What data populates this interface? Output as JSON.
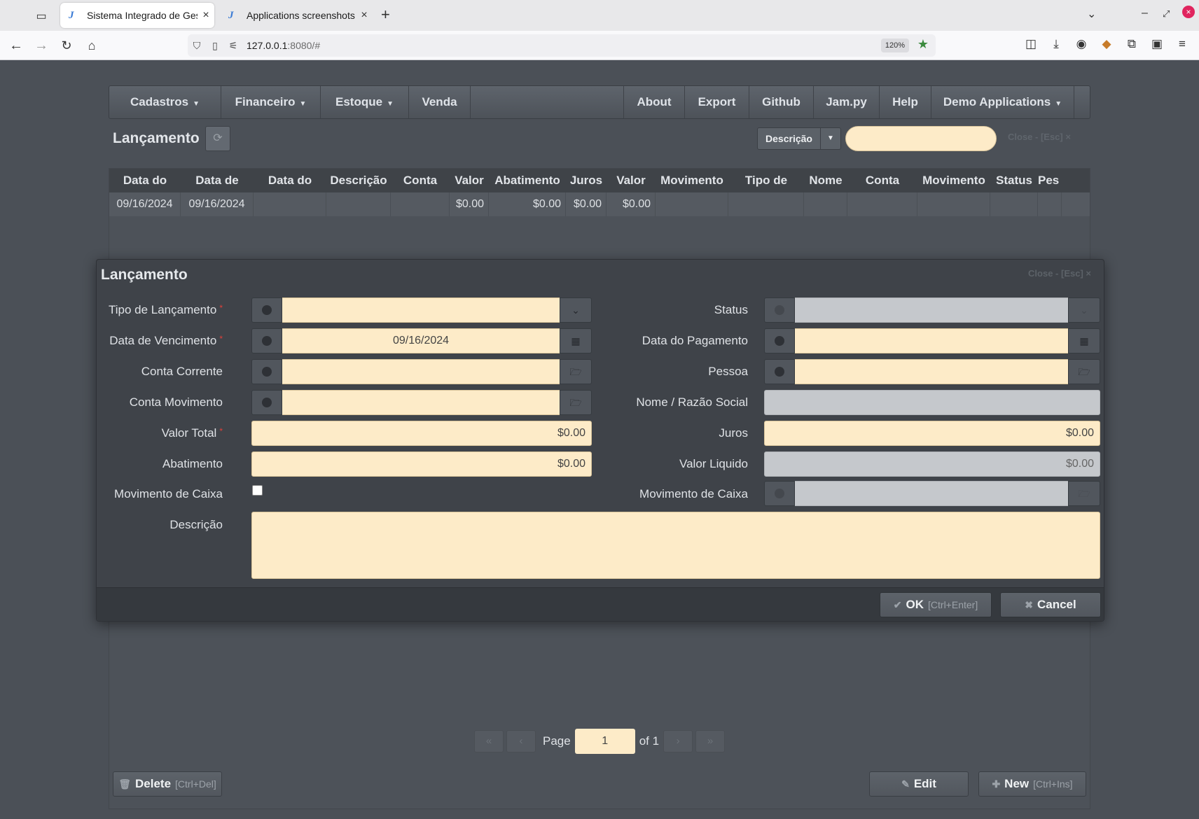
{
  "browser": {
    "tabs": [
      {
        "label": "Sistema Integrado de Gestã",
        "active": true,
        "favicon": "J"
      },
      {
        "label": "Applications screenshots —",
        "active": false,
        "favicon": "J"
      }
    ],
    "url_host": "127.0.0.1",
    "url_rest": ":8080/#",
    "zoom": "120%"
  },
  "menu": {
    "left": [
      "Cadastros",
      "Financeiro",
      "Estoque",
      "Venda"
    ],
    "right": [
      "About",
      "Export",
      "Github",
      "Jam.py",
      "Help",
      "Demo Applications"
    ]
  },
  "view": {
    "title": "Lançamento",
    "search_field": "Descrição",
    "close_hint": "Close - [Esc] ×"
  },
  "table": {
    "columns": [
      "Data do",
      "Data de",
      "Data do",
      "Descrição",
      "Conta",
      "Valor",
      "Abatimento",
      "Juros",
      "Valor",
      "Movimento",
      "Tipo de",
      "Nome",
      "Conta",
      "Movimento",
      "Status",
      "Pes"
    ],
    "rows": [
      [
        "09/16/2024",
        "09/16/2024",
        "",
        "",
        "",
        "$0.00",
        "$0.00",
        "$0.00",
        "$0.00",
        "",
        "",
        "",
        "",
        "",
        "",
        ""
      ]
    ]
  },
  "pager": {
    "page_label": "Page",
    "page": "1",
    "of_label": "of 1"
  },
  "footer": {
    "delete": "Delete",
    "delete_hk": "[Ctrl+Del]",
    "edit": "Edit",
    "new": "New",
    "new_hk": "[Ctrl+Ins]"
  },
  "modal": {
    "title": "Lançamento",
    "close_hint": "Close - [Esc] ×",
    "left_fields": {
      "tipo": "Tipo de Lançamento",
      "vencimento": "Data de Vencimento",
      "vencimento_value": "09/16/2024",
      "conta_corrente": "Conta Corrente",
      "conta_movimento": "Conta Movimento",
      "valor_total": "Valor Total",
      "valor_total_value": "$0.00",
      "abatimento": "Abatimento",
      "abatimento_value": "$0.00",
      "mov_caixa": "Movimento de Caixa",
      "descricao": "Descrição"
    },
    "right_fields": {
      "status": "Status",
      "pagamento": "Data do Pagamento",
      "pessoa": "Pessoa",
      "nome": "Nome / Razão Social",
      "juros": "Juros",
      "juros_value": "$0.00",
      "valor_liquido": "Valor Liquido",
      "valor_liquido_value": "$0.00",
      "mov_caixa": "Movimento de Caixa"
    },
    "ok": "OK",
    "ok_hk": "[Ctrl+Enter]",
    "cancel": "Cancel"
  }
}
